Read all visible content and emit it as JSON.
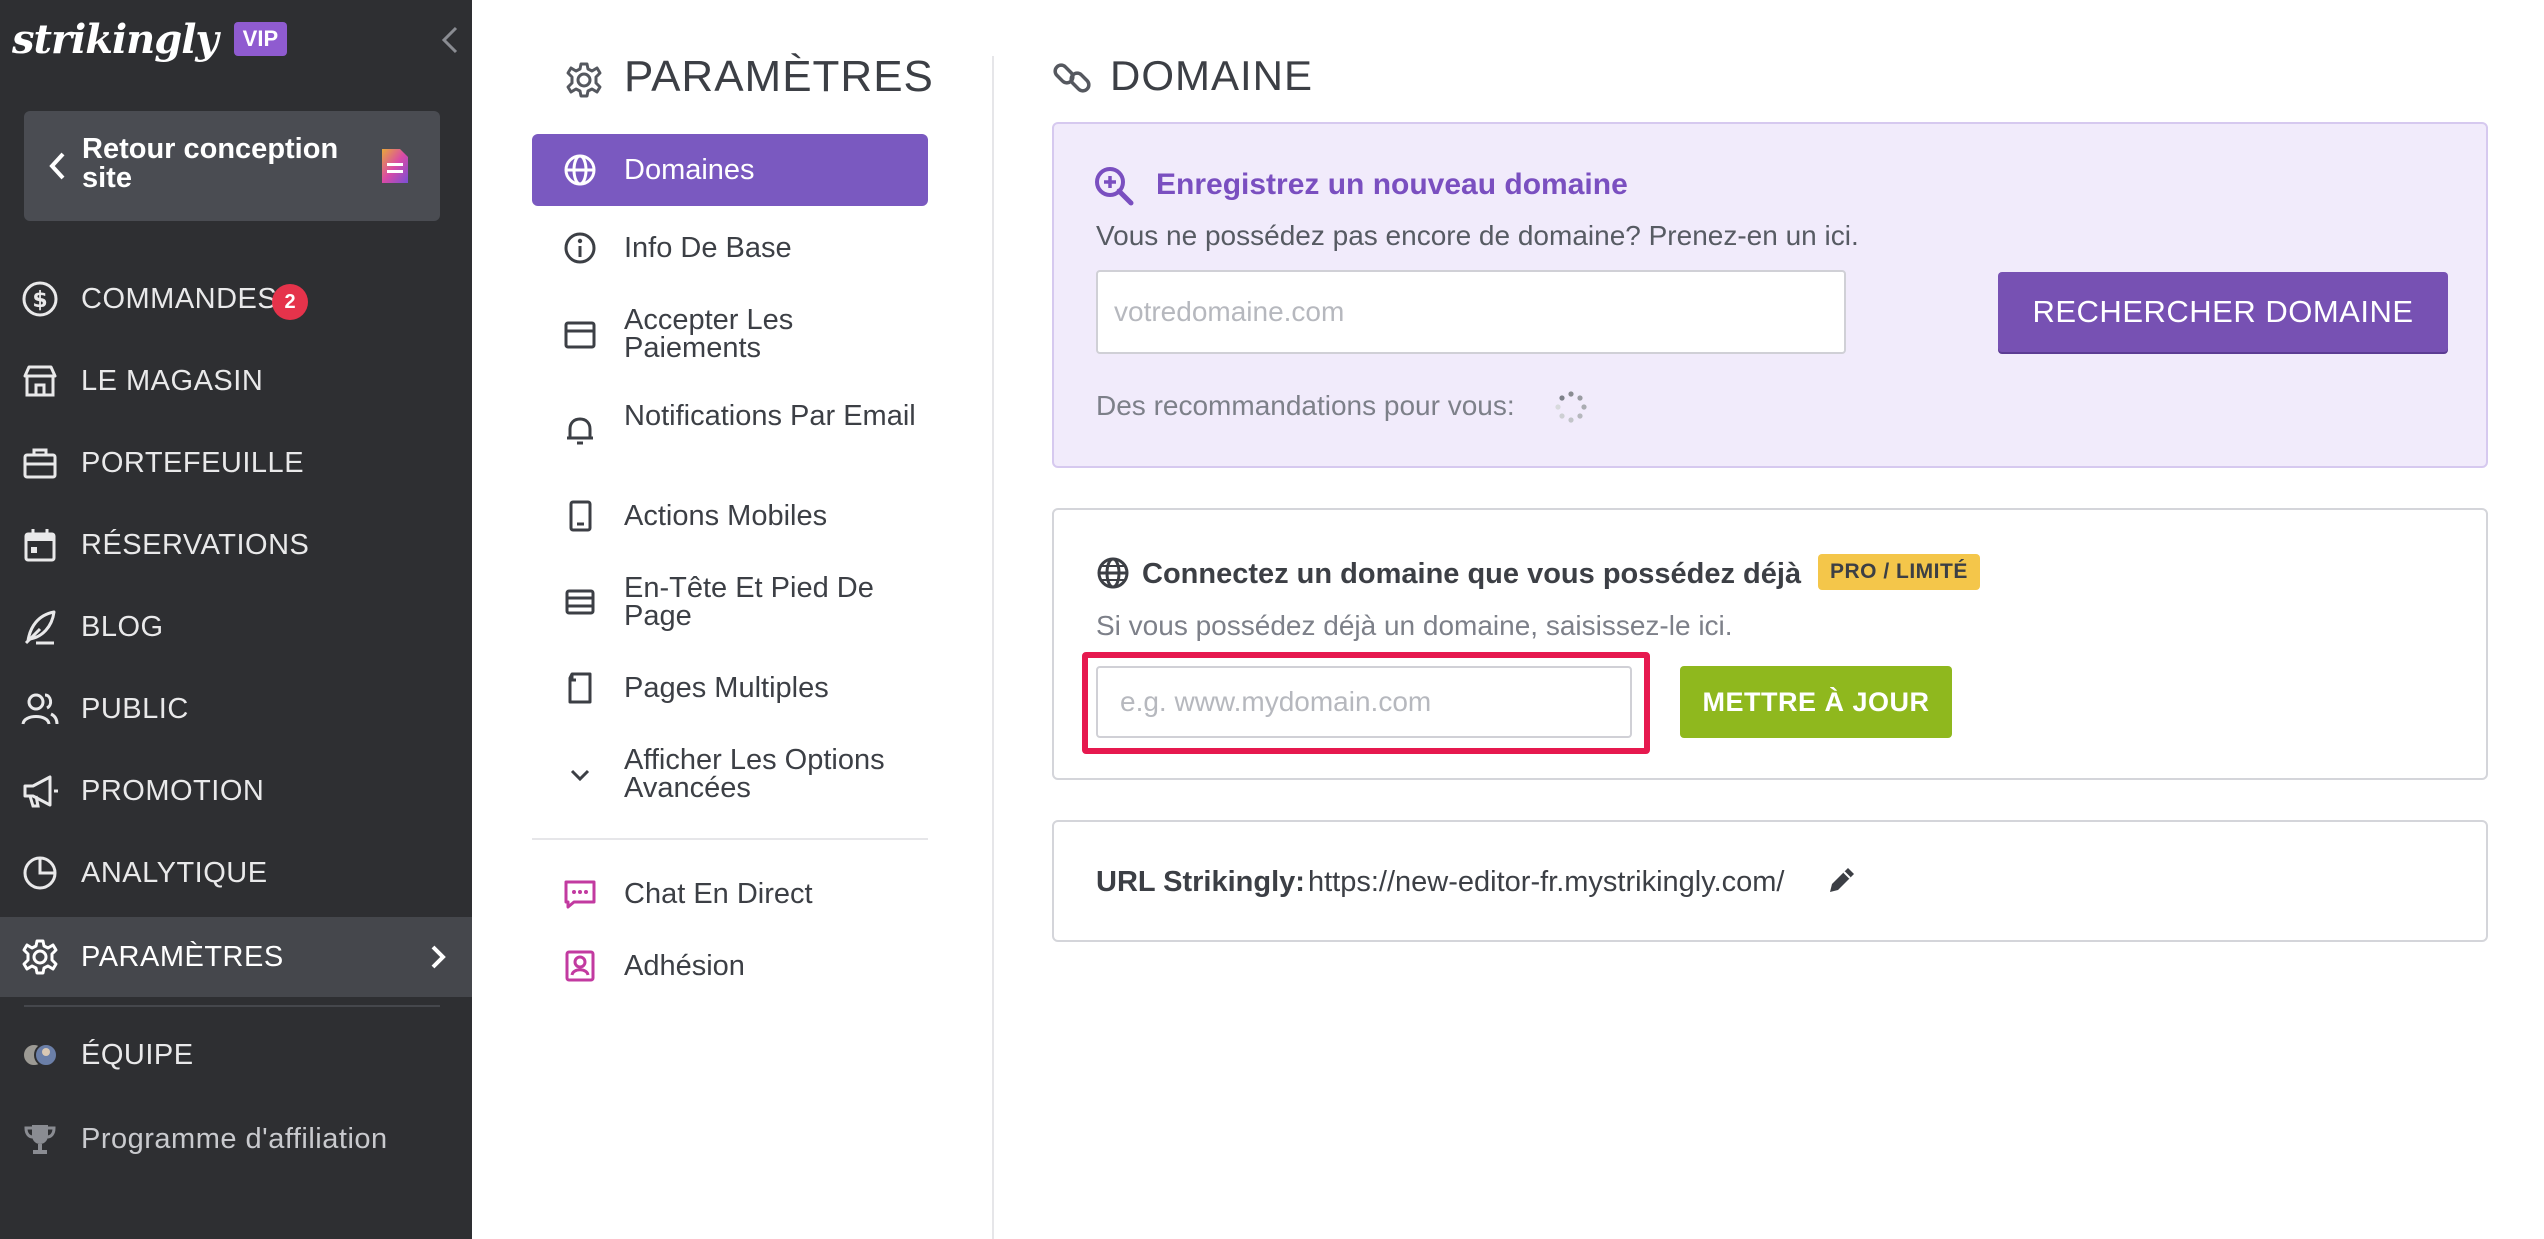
{
  "sidebar": {
    "logo": "strikingly",
    "vip_badge": "VIP",
    "back_label": "Retour conception site",
    "items": [
      {
        "label": "COMMANDES",
        "icon": "dollar-circle-icon",
        "badge": "2"
      },
      {
        "label": "LE MAGASIN",
        "icon": "store-icon"
      },
      {
        "label": "PORTEFEUILLE",
        "icon": "briefcase-icon"
      },
      {
        "label": "RÉSERVATIONS",
        "icon": "calendar-icon"
      },
      {
        "label": "BLOG",
        "icon": "quill-icon"
      },
      {
        "label": "PUBLIC",
        "icon": "users-icon"
      },
      {
        "label": "PROMOTION",
        "icon": "megaphone-icon"
      },
      {
        "label": "ANALYTIQUE",
        "icon": "pie-chart-icon"
      },
      {
        "label": "PARAMÈTRES",
        "icon": "gear-icon",
        "active": true
      },
      {
        "label": "ÉQUIPE",
        "icon": "team-avatars-icon"
      },
      {
        "label": "Programme d'affiliation",
        "icon": "trophy-icon"
      }
    ]
  },
  "settings": {
    "title": "PARAMÈTRES",
    "items": [
      {
        "label": "Domaines",
        "icon": "globe-icon",
        "active": true
      },
      {
        "label": "Info De Base",
        "icon": "info-icon"
      },
      {
        "label": "Accepter Les Paiements",
        "icon": "wallet-icon"
      },
      {
        "label": "Notifications Par Email",
        "icon": "bell-icon"
      },
      {
        "label": "Actions Mobiles",
        "icon": "tablet-icon"
      },
      {
        "label": "En-Tête Et Pied De Page",
        "icon": "layout-icon"
      },
      {
        "label": "Pages Multiples",
        "icon": "pages-icon"
      },
      {
        "label": "Afficher Les Options Avancées",
        "icon": "chevron-down-icon"
      },
      {
        "label": "Chat En Direct",
        "icon": "chat-icon"
      },
      {
        "label": "Adhésion",
        "icon": "member-icon"
      }
    ]
  },
  "domain": {
    "title": "DOMAINE",
    "register": {
      "title": "Enregistrez un nouveau domaine",
      "subtitle": "Vous ne possédez pas encore de domaine? Prenez-en un ici.",
      "placeholder": "votredomaine.com",
      "button": "RECHERCHER DOMAINE",
      "recommendations": "Des recommandations pour vous:"
    },
    "connect": {
      "title": "Connectez un domaine que vous possédez déjà",
      "badge": "PRO / LIMITÉ",
      "subtitle": "Si vous possédez déjà un domaine, saisissez-le ici.",
      "placeholder": "e.g. www.mydomain.com",
      "button": "METTRE À JOUR"
    },
    "url": {
      "label": "URL Strikingly:",
      "value": "https://new-editor-fr.mystrikingly.com/"
    }
  },
  "colors": {
    "sidebar_bg": "#2e2f32",
    "accent_purple": "#7751b3",
    "accent_green": "#8fb81e",
    "highlight_red": "#e6194f",
    "badge_yellow": "#f4c64a"
  }
}
